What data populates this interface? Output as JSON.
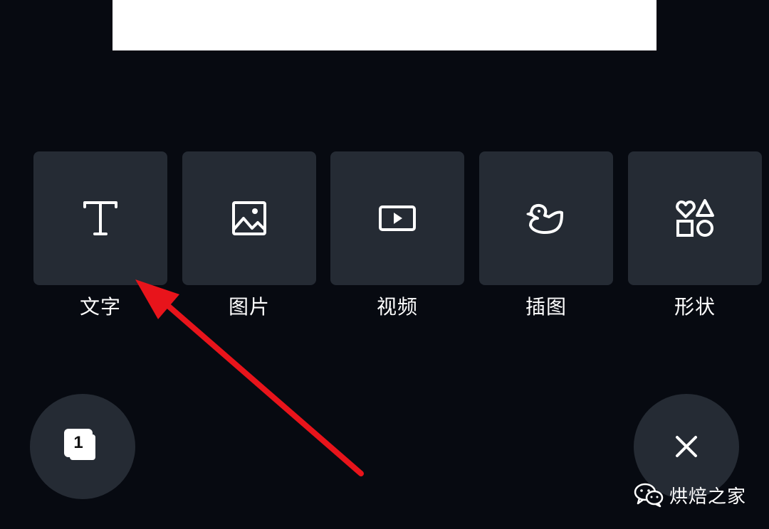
{
  "insert_panel": {
    "items": [
      {
        "label": "文字",
        "icon": "text-icon"
      },
      {
        "label": "图片",
        "icon": "image-icon"
      },
      {
        "label": "视频",
        "icon": "video-icon"
      },
      {
        "label": "插图",
        "icon": "illustration-duck-icon"
      },
      {
        "label": "形状",
        "icon": "shapes-icon"
      }
    ]
  },
  "pages_button": {
    "count": "1",
    "icon": "pages-stack-icon"
  },
  "close_button": {
    "icon": "close-icon"
  },
  "watermark": {
    "text": "烘焙之家",
    "icon": "wechat-icon"
  },
  "annotation": {
    "icon": "red-arrow",
    "color": "#e8141b"
  },
  "colors": {
    "background": "#070a11",
    "tile": "#252b34",
    "text": "#ffffff"
  }
}
